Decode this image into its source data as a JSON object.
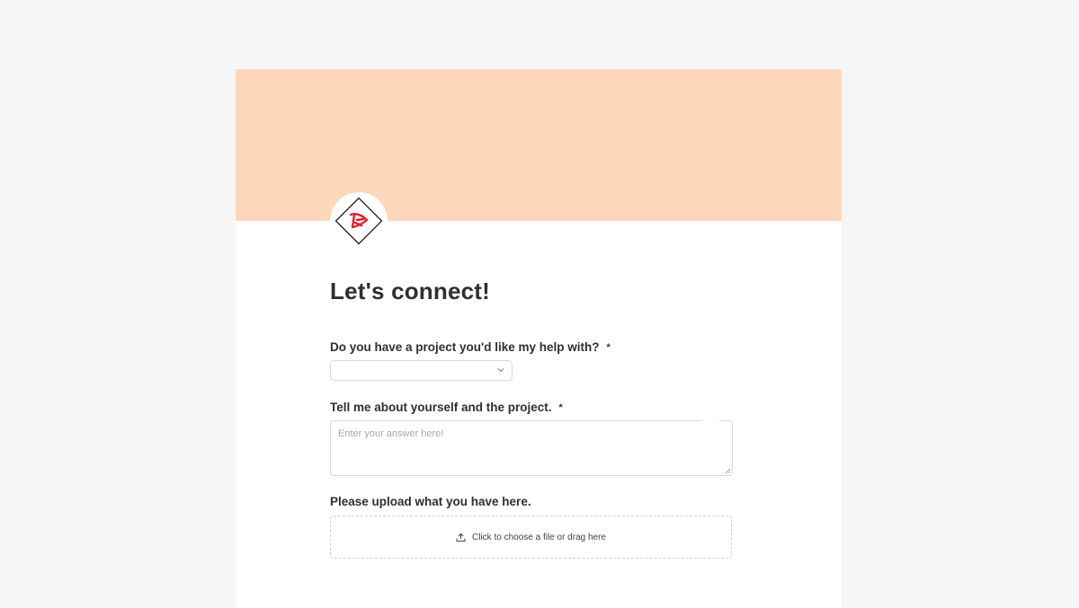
{
  "colors": {
    "page_background": "#f6f6f6",
    "cover": "#ffd7bb",
    "logo_red": "#e0202a"
  },
  "form": {
    "title": "Let's connect!",
    "required_marker": "*",
    "questions": [
      {
        "label": "Do you have a project you'd like my help with?",
        "type": "select",
        "selected_value": "",
        "required": true
      },
      {
        "label": "Tell me about yourself and the project.",
        "type": "textarea",
        "placeholder": "Enter your answer here!",
        "required": true
      },
      {
        "label": "Please upload what you have here.",
        "type": "file",
        "upload_text": "Click to choose a file or drag here",
        "required": false
      }
    ]
  },
  "icons": {
    "logo": "diamond-logo-icon",
    "select": "chevron-down-icon",
    "upload": "upload-icon",
    "resize": "resize-handle-icon"
  }
}
